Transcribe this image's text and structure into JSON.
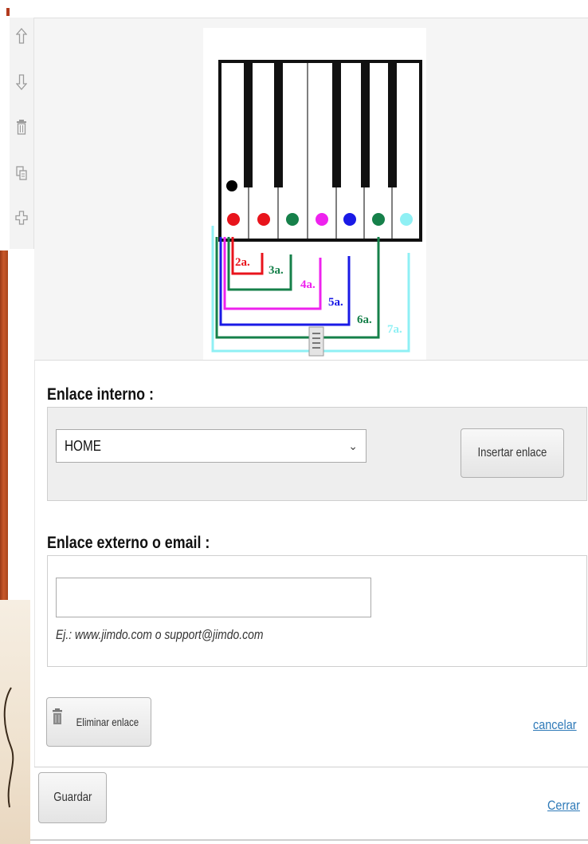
{
  "toolbar": {
    "items": [
      {
        "name": "move-up",
        "icon": "arrow-up-icon"
      },
      {
        "name": "move-down",
        "icon": "arrow-down-icon"
      },
      {
        "name": "delete",
        "icon": "trash-icon"
      },
      {
        "name": "copy",
        "icon": "copy-icon"
      },
      {
        "name": "add",
        "icon": "plus-icon"
      }
    ]
  },
  "image": {
    "labels": [
      "2a.",
      "3a.",
      "4a.",
      "5a.",
      "6a.",
      "7a."
    ],
    "colors": {
      "red": "#e8141c",
      "green": "#16804a",
      "magenta": "#ee22ee",
      "blue": "#1a1ae6",
      "cyan": "#8ff0f4",
      "black": "#000000"
    }
  },
  "form": {
    "internal_title": "Enlace interno :",
    "internal_select_value": "HOME",
    "insert_button": "Insertar enlace",
    "external_title": "Enlace externo o email :",
    "external_input_value": "",
    "external_hint": "Ej.: www.jimdo.com o support@jimdo.com",
    "delete_button": "Eliminar enlace",
    "cancel_link": "cancelar"
  },
  "footer": {
    "save_button": "Guardar",
    "close_link": "Cerrar"
  }
}
